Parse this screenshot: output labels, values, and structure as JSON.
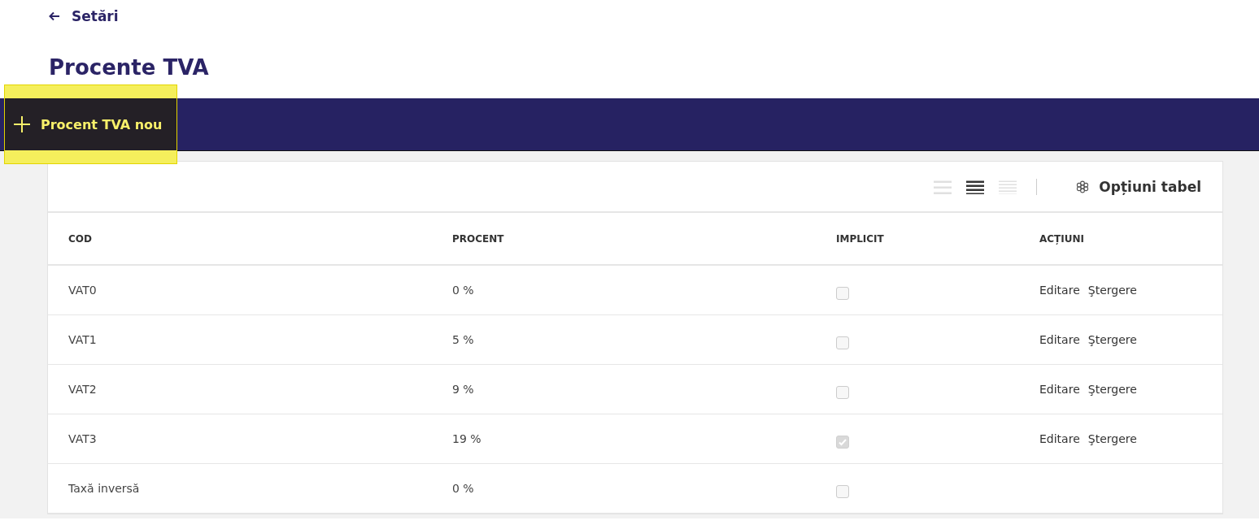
{
  "back_link": {
    "label": "Setări"
  },
  "page_title": "Procente TVA",
  "toolbar": {
    "new_button": {
      "label": "Procent TVA nou",
      "highlighted": true
    }
  },
  "table_toolbar": {
    "density_options": [
      {
        "kind": "compact",
        "selected": false
      },
      {
        "kind": "normal",
        "selected": true
      },
      {
        "kind": "comfortable",
        "selected": false
      }
    ],
    "options_button": {
      "label": "Opțiuni tabel"
    }
  },
  "table": {
    "columns": [
      "COD",
      "PROCENT",
      "IMPLICIT",
      "ACȚIUNI"
    ],
    "rows": [
      {
        "code": "VAT0",
        "percent": "0 %",
        "default": false,
        "actions": [
          "Editare",
          "Ştergere"
        ]
      },
      {
        "code": "VAT1",
        "percent": "5 %",
        "default": false,
        "actions": [
          "Editare",
          "Ştergere"
        ]
      },
      {
        "code": "VAT2",
        "percent": "9 %",
        "default": false,
        "actions": [
          "Editare",
          "Ştergere"
        ]
      },
      {
        "code": "VAT3",
        "percent": "19 %",
        "default": true,
        "actions": [
          "Editare",
          "Ştergere"
        ]
      },
      {
        "code": "Taxă inversă",
        "percent": "0 %",
        "default": false
      }
    ]
  }
}
